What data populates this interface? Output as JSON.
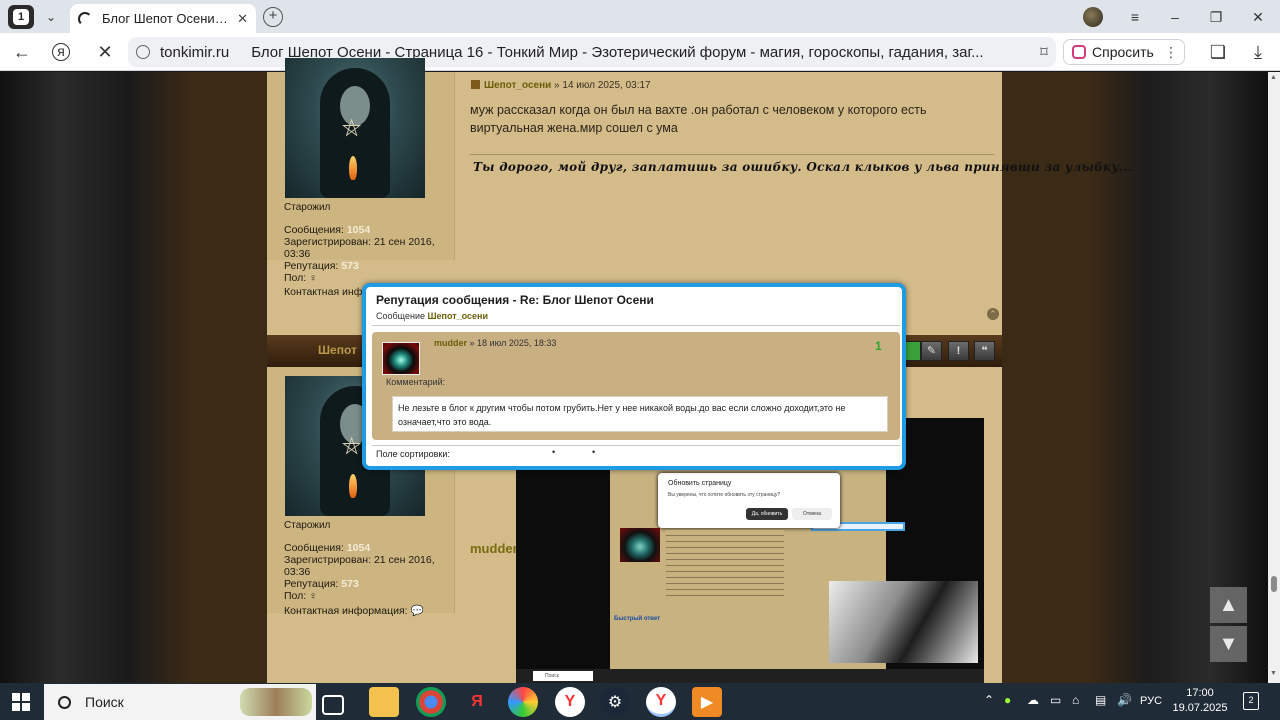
{
  "browser": {
    "tab_count": "1",
    "tab_title": "Блог Шепот Осени - Стр",
    "url_domain": "tonkimir.ru",
    "page_title": "Блог Шепот Осени - Страница 16 - Тонкий Мир - Эзотерический форум - магия, гороскопы, гадания, заг...",
    "ask_button": "Спросить"
  },
  "post1": {
    "author": "Шепот_осени",
    "date": "» 14 июл 2025, 03:17",
    "text": "муж рассказал когда он был на вахте .он работал с человеком у которого есть виртуальная жена.мир сошел с ума",
    "signature": "Ты дорого, мой друг, заплатишь за ошибку. Оскал клыков у льва принявши за улыбку..."
  },
  "profile": {
    "rank": "Старожил",
    "posts_label": "Сообщения:",
    "posts": "1054",
    "registered_label": "Зарегистрирован:",
    "registered_date": "21 сен 2016,",
    "registered_time": "03:36",
    "reputation_label": "Репутация:",
    "reputation": "573",
    "gender_label": "Пол:",
    "gender_symbol": "♀",
    "contact_label": "Контактная информация:",
    "contact_label_short": "Контактная инф"
  },
  "post2": {
    "bar_name": "Шепот",
    "author_partial": "mudder"
  },
  "popup": {
    "title": "Репутация сообщения - Re: Блог Шепот Осени",
    "subtitle_prefix": "Сообщение",
    "subtitle_user": "Шепот_осени",
    "voter": "mudder",
    "vote_date": "» 18 июл 2025, 18:33",
    "points": "1",
    "comment_label": "Комментарий:",
    "comment": "Не лезьте в блог к другим чтобы потом грубить.Нет у нее никакой воды.до вас если сложно доходит,это не означает,что это вода.",
    "sort_label": "Поле сортировки:",
    "sort_dot_1": "•",
    "sort_dot_2": "•"
  },
  "embedded_screenshot": {
    "dialog_title": "Обновить страницу",
    "dialog_text": "Вы уверены, что хотите обновить эту страницу?",
    "dialog_ok": "Да, обновить",
    "dialog_cancel": "Отмена",
    "quick_reply": "Быстрый ответ",
    "search_placeholder": "Поиск"
  },
  "taskbar": {
    "search_placeholder": "Поиск",
    "language": "РУС",
    "time": "17:00",
    "date": "19.07.2025",
    "notifications": "2"
  },
  "colors": {
    "accent_blue": "#1e9be2",
    "username_olive": "#6b5e0a",
    "reputation_green": "#2da52d",
    "parchment": "#d3bc8a"
  }
}
